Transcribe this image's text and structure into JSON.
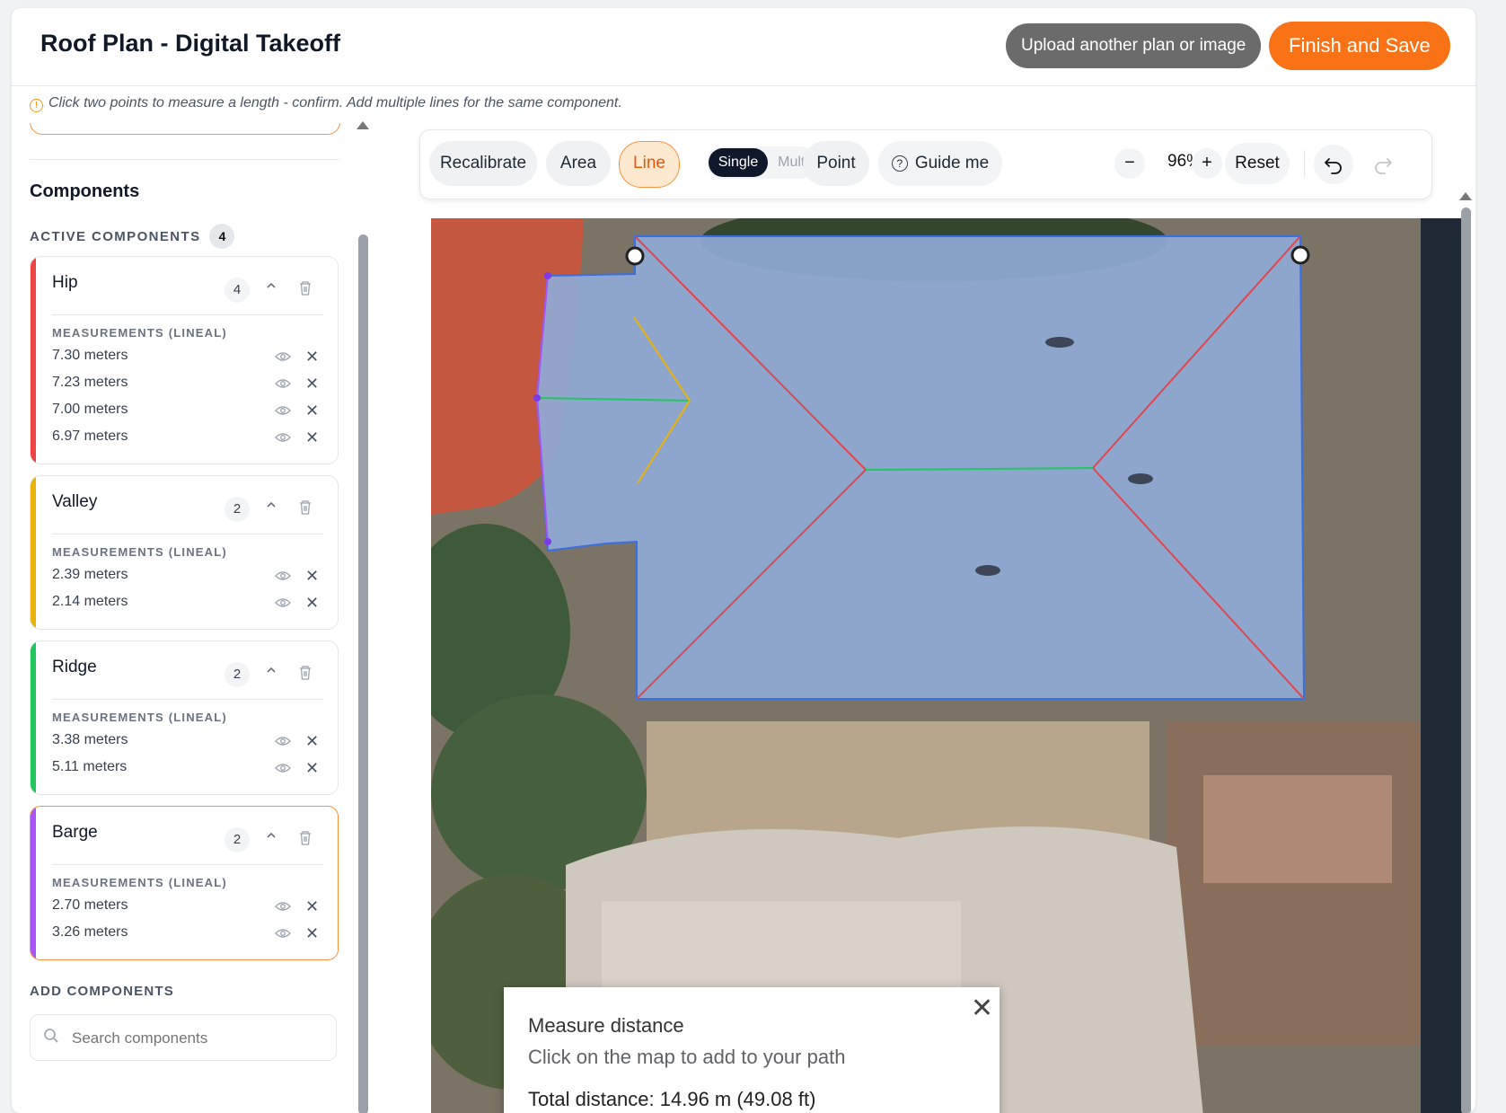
{
  "header": {
    "title": "Roof Plan - Digital Takeoff",
    "upload_label": "Upload another plan or image",
    "finish_label": "Finish and Save"
  },
  "hint": "Click two points to measure a length - confirm. Add multiple lines for the same component.",
  "sidebar": {
    "components_heading": "Components",
    "active_heading": "ACTIVE COMPONENTS",
    "active_count": "4",
    "measurements_heading": "MEASUREMENTS (LINEAL)",
    "add_heading": "ADD COMPONENTS",
    "search_placeholder": "Search components",
    "components": [
      {
        "name": "Hip",
        "count": "4",
        "color": "#ef4444",
        "measurements": [
          "7.30 meters",
          "7.23 meters",
          "7.00 meters",
          "6.97 meters"
        ]
      },
      {
        "name": "Valley",
        "count": "2",
        "color": "#eab308",
        "measurements": [
          "2.39 meters",
          "2.14 meters"
        ]
      },
      {
        "name": "Ridge",
        "count": "2",
        "color": "#22c55e",
        "measurements": [
          "3.38 meters",
          "5.11 meters"
        ]
      },
      {
        "name": "Barge",
        "count": "2",
        "color": "#a855f7",
        "measurements": [
          "2.70 meters",
          "3.26 meters"
        ]
      }
    ]
  },
  "toolbar": {
    "recalibrate": "Recalibrate",
    "area": "Area",
    "line": "Line",
    "single": "Single",
    "multi": "Multi",
    "point": "Point",
    "guide": "Guide me",
    "zoom_out": "−",
    "zoom": "96%",
    "zoom_in": "+",
    "reset": "Reset"
  },
  "measure_popup": {
    "title": "Measure distance",
    "subtitle": "Click on the map to add to your path",
    "total": "Total distance: 14.96 m (49.08 ft)"
  },
  "colors": {
    "accent": "#f97316",
    "hip": "#ef4444",
    "valley": "#eab308",
    "ridge": "#22c55e",
    "barge": "#a855f7",
    "area_outline": "#3b6fe0"
  }
}
